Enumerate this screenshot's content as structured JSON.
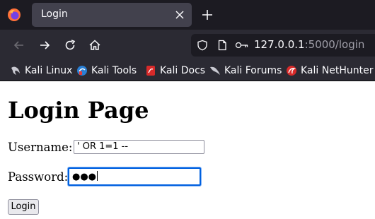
{
  "browser": {
    "tab": {
      "title": "Login"
    },
    "url": {
      "host": "127.0.0.1",
      "path": ":5000/login"
    },
    "bookmarks": [
      {
        "label": "Kali Linux",
        "icon": "kali-dragon-icon"
      },
      {
        "label": "Kali Tools",
        "icon": "kali-tools-icon"
      },
      {
        "label": "Kali Docs",
        "icon": "kali-docs-icon"
      },
      {
        "label": "Kali Forums",
        "icon": "kali-forums-icon"
      },
      {
        "label": "Kali NetHunter",
        "icon": "kali-nethunter-icon"
      }
    ],
    "colors": {
      "tabbar": "#1c1b22",
      "toolbar": "#2b2a33",
      "focus": "#0060df"
    }
  },
  "page": {
    "heading": "Login Page",
    "username": {
      "label": "Username:",
      "value": "' OR 1=1 --"
    },
    "password": {
      "label": "Password:",
      "value": "●●●"
    },
    "submit_label": "Login"
  }
}
